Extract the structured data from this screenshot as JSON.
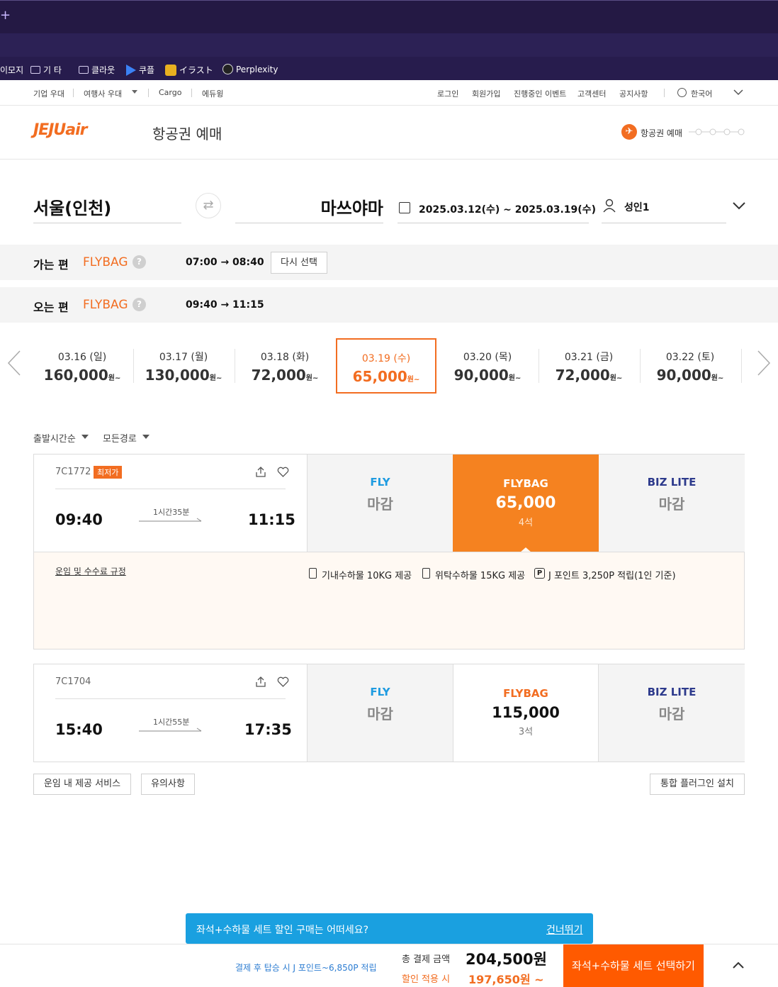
{
  "browser": {
    "tab_plus": "+",
    "bookmarks": [
      "이모지",
      "기 타",
      "클라웃",
      "쿠플",
      "イラスト",
      "Perplexity"
    ]
  },
  "util_nav": {
    "left": [
      "기업 우대",
      "여행사 우대",
      "Cargo",
      "에듀윙"
    ],
    "right": [
      "로그인",
      "회원가입",
      "진행중인 이벤트",
      "고객센터",
      "공지사항"
    ],
    "language": "한국어"
  },
  "header": {
    "logo": "JEJUair",
    "title": "항공권 예매",
    "step_label": "항공권 예매"
  },
  "search": {
    "origin": "서울(인천)",
    "destination": "마쓰야마",
    "dates": "2025.03.12(수) ~ 2025.03.19(수)",
    "passengers": "성인1"
  },
  "outbound": {
    "label": "가는 편",
    "fare": "FLYBAG",
    "time": "07:00 → 08:40",
    "reselect": "다시 선택"
  },
  "inbound": {
    "label": "오는 편",
    "fare": "FLYBAG",
    "time": "09:40 → 11:15"
  },
  "dates": [
    {
      "date": "03.16 (일)",
      "price": "160,000",
      "unit": "원~"
    },
    {
      "date": "03.17 (월)",
      "price": "130,000",
      "unit": "원~"
    },
    {
      "date": "03.18 (화)",
      "price": "72,000",
      "unit": "원~"
    },
    {
      "date": "03.19 (수)",
      "price": "65,000",
      "unit": "원~"
    },
    {
      "date": "03.20 (목)",
      "price": "90,000",
      "unit": "원~"
    },
    {
      "date": "03.21 (금)",
      "price": "72,000",
      "unit": "원~"
    },
    {
      "date": "03.22 (토)",
      "price": "90,000",
      "unit": "원~"
    }
  ],
  "sort": {
    "order": "출발시간순",
    "route": "모든경로"
  },
  "flights": [
    {
      "number": "7C1772",
      "badge": "최저가",
      "depart": "09:40",
      "arrive": "11:15",
      "duration": "1시간35분",
      "fly": {
        "name": "FLY",
        "price": "마감"
      },
      "flybag": {
        "name": "FLYBAG",
        "price": "65,000",
        "seats": "4석"
      },
      "bizlite": {
        "name": "BIZ LITE",
        "price": "마감"
      }
    },
    {
      "number": "7C1704",
      "depart": "15:40",
      "arrive": "17:35",
      "duration": "1시간55분",
      "fly": {
        "name": "FLY",
        "price": "마감"
      },
      "flybag": {
        "name": "FLYBAG",
        "price": "115,000",
        "seats": "3석"
      },
      "bizlite": {
        "name": "BIZ LITE",
        "price": "마감"
      }
    }
  ],
  "detail": {
    "rules_link": "운임 및 수수료 규정",
    "cabin_bag": "기내수하물 10KG 제공",
    "checked_bag": "위탁수하물 15KG 제공",
    "points": "J 포인트 3,250P 적립(1인 기준)"
  },
  "bottom_buttons": {
    "fare_services": "운임 내 제공 서비스",
    "notes": "유의사항",
    "plugin": "통합 플러그인 설치"
  },
  "promo": {
    "text": "좌석+수하물 세트 할인 구매는 어떠세요?",
    "skip": "건너뛰기"
  },
  "footer": {
    "points_note": "결제 후 탑승 시 J 포인트~6,850P 적립",
    "total_label": "총 결제 금액",
    "total": "204,500원",
    "discount_label": "할인 적용 시",
    "discount_total": "197,650원 ~",
    "cta": "좌석+수하물 세트 선택하기"
  },
  "colors": {
    "brand_orange": "#f26d21",
    "fly_blue": "#1e9be0",
    "bizlite_navy": "#2d3a8c",
    "promo_blue": "#1aa0e0"
  }
}
